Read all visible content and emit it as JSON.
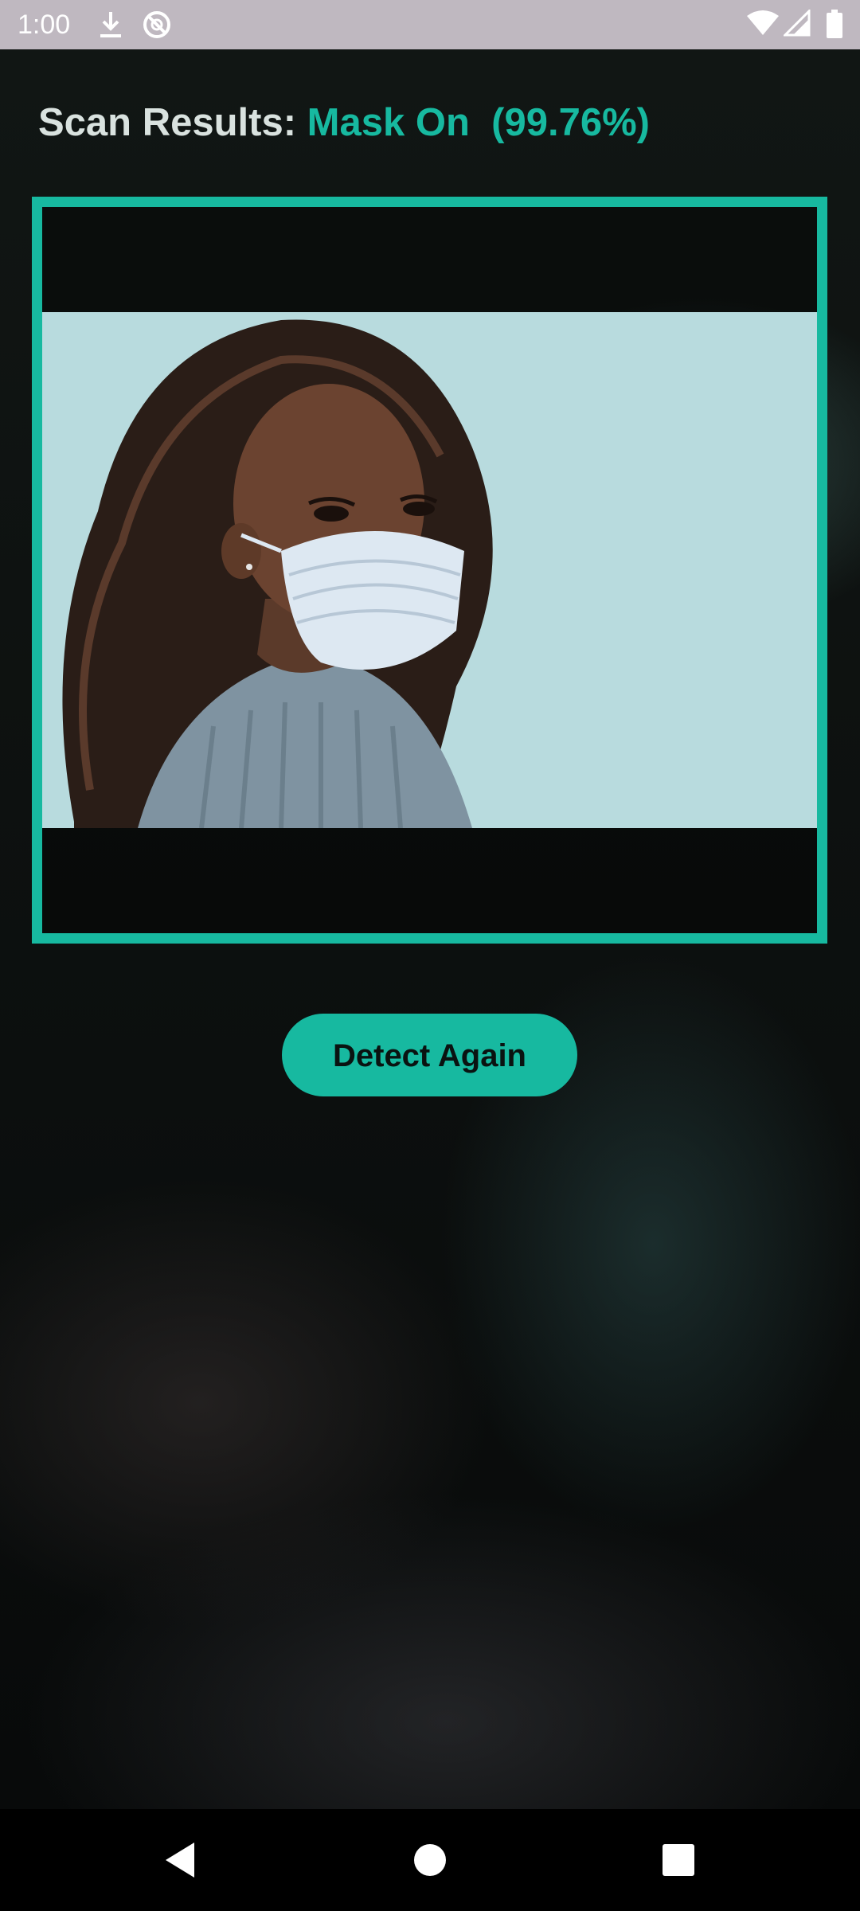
{
  "status_bar": {
    "time": "1:00",
    "left_icons": [
      "download-icon",
      "sync-disabled-icon"
    ],
    "right_icons": [
      "wifi-icon",
      "cell-signal-icon",
      "battery-icon"
    ]
  },
  "result": {
    "label": "Scan Results: ",
    "status": "Mask On",
    "confidence": "(99.76%)"
  },
  "scanned_image": {
    "description_icon": "person-wearing-mask-photo"
  },
  "actions": {
    "detect_again": "Detect Again"
  },
  "nav_bar": {
    "buttons": [
      "back-icon",
      "home-icon",
      "recents-icon"
    ]
  },
  "colors": {
    "accent": "#17b9a0",
    "status_bar": "#bfb8c0",
    "photo_bg": "#b8dbde"
  }
}
